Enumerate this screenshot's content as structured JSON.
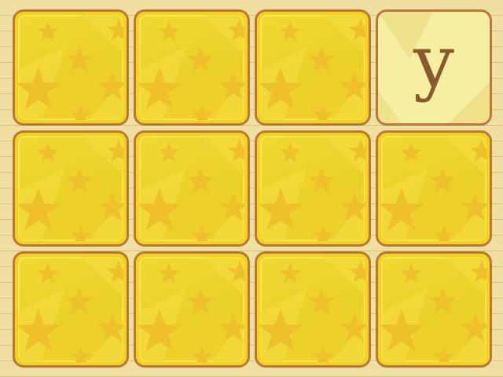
{
  "game": {
    "type": "memory-match",
    "rows": 3,
    "columns": 4,
    "cards": [
      {
        "state": "face-down",
        "letter": ""
      },
      {
        "state": "face-down",
        "letter": ""
      },
      {
        "state": "face-down",
        "letter": ""
      },
      {
        "state": "face-up",
        "letter": "y"
      },
      {
        "state": "face-down",
        "letter": ""
      },
      {
        "state": "face-down",
        "letter": ""
      },
      {
        "state": "face-down",
        "letter": ""
      },
      {
        "state": "face-down",
        "letter": ""
      },
      {
        "state": "face-down",
        "letter": ""
      },
      {
        "state": "face-down",
        "letter": ""
      },
      {
        "state": "face-down",
        "letter": ""
      },
      {
        "state": "face-down",
        "letter": ""
      }
    ]
  },
  "colors": {
    "background": "#efdfa2",
    "card_back": "#f5d21e",
    "card_face": "#f6eea0",
    "card_border": "#b8773b",
    "letter": "#8a5a2c",
    "star": "#eec12c"
  },
  "icons": {
    "card_back_pattern": "star-icon"
  }
}
